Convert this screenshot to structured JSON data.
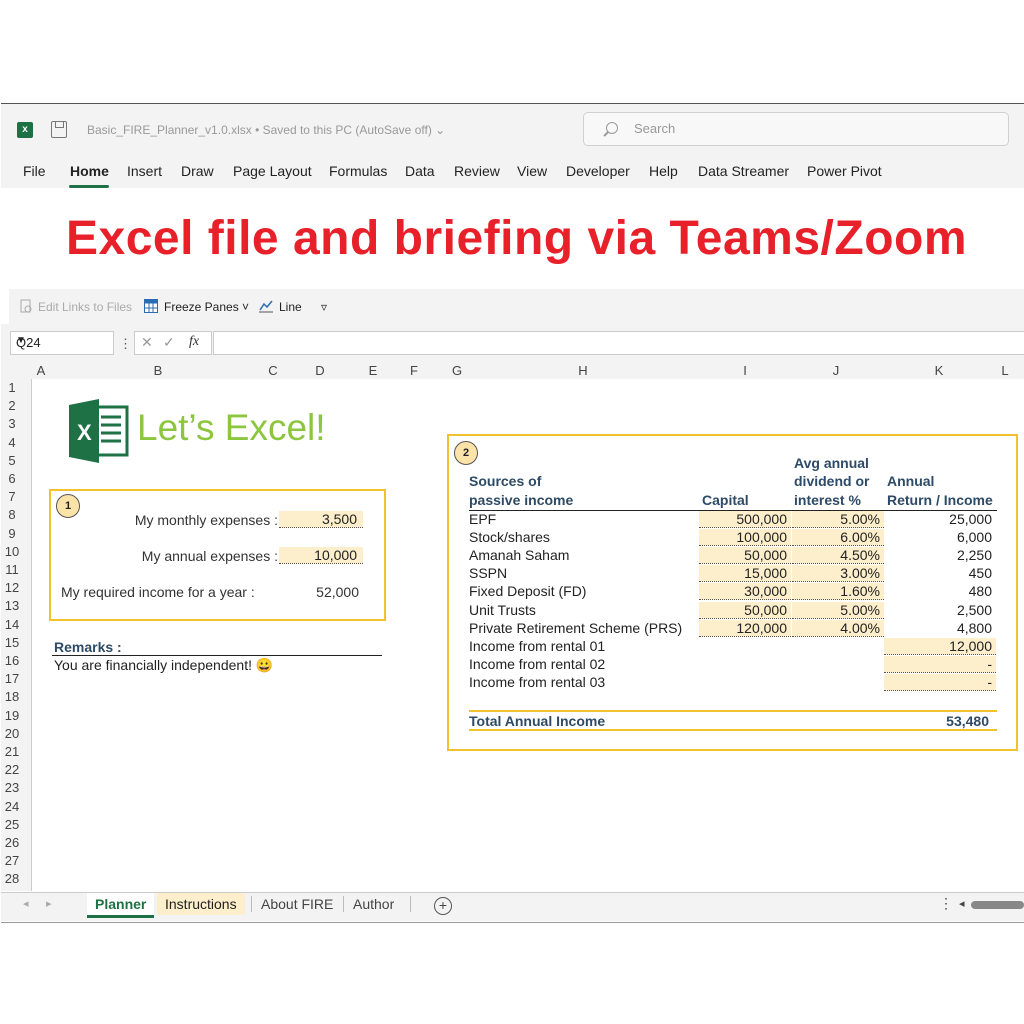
{
  "titlebar": {
    "filename": "Basic_FIRE_Planner_v1.0.xlsx • Saved to this PC (AutoSave off) ⌄",
    "search_placeholder": "Search"
  },
  "menu": [
    "File",
    "Home",
    "Insert",
    "Draw",
    "Page Layout",
    "Formulas",
    "Data",
    "Review",
    "View",
    "Developer",
    "Help",
    "Data Streamer",
    "Power Pivot"
  ],
  "banner": "Excel file and briefing via Teams/Zoom",
  "ribbon": {
    "edit_links": "Edit Links to Files",
    "freeze_panes": "Freeze Panes ˅",
    "line": "Line",
    "more": "▿"
  },
  "formula_bar": {
    "name_box": "Q24",
    "fx": "fx"
  },
  "columns": [
    "A",
    "B",
    "C",
    "D",
    "E",
    "F",
    "G",
    "H",
    "I",
    "J",
    "K",
    "L"
  ],
  "rows": [
    "1",
    "2",
    "3",
    "4",
    "5",
    "6",
    "7",
    "8",
    "9",
    "10",
    "11",
    "12",
    "13",
    "14",
    "15",
    "16",
    "17",
    "18",
    "19",
    "20",
    "21",
    "22",
    "23",
    "24",
    "25",
    "26",
    "27",
    "28"
  ],
  "logo_text": "Let’s Excel!",
  "box1": {
    "badge": "1",
    "monthly_label": "My monthly expenses  :",
    "monthly_value": "3,500",
    "annual_label": "My annual expenses  :",
    "annual_value": "10,000",
    "required_label": "My required income for a year  :",
    "required_value": "52,000"
  },
  "remarks": {
    "title": "Remarks :",
    "value": "You are financially independent! 😀"
  },
  "box2": {
    "badge": "2",
    "headers": {
      "source1": "Sources of",
      "source2": "passive income",
      "capital": "Capital",
      "avg1": "Avg annual",
      "avg2": "dividend or",
      "avg3": "interest %",
      "ret1": "Annual",
      "ret2": "Return / Income"
    },
    "rows": [
      {
        "name": "EPF",
        "capital": "500,000",
        "rate": "5.00%",
        "income": "25,000"
      },
      {
        "name": "Stock/shares",
        "capital": "100,000",
        "rate": "6.00%",
        "income": "6,000"
      },
      {
        "name": "Amanah Saham",
        "capital": "50,000",
        "rate": "4.50%",
        "income": "2,250"
      },
      {
        "name": "SSPN",
        "capital": "15,000",
        "rate": "3.00%",
        "income": "450"
      },
      {
        "name": "Fixed Deposit (FD)",
        "capital": "30,000",
        "rate": "1.60%",
        "income": "480"
      },
      {
        "name": "Unit Trusts",
        "capital": "50,000",
        "rate": "5.00%",
        "income": "2,500"
      },
      {
        "name": "Private Retirement Scheme (PRS)",
        "capital": "120,000",
        "rate": "4.00%",
        "income": "4,800"
      }
    ],
    "rentals": [
      {
        "name": "Income from rental 01",
        "income": "12,000"
      },
      {
        "name": "Income from rental 02",
        "income": "-"
      },
      {
        "name": "Income from rental 03",
        "income": "-"
      }
    ],
    "total_label": "Total Annual Income",
    "total_value": "53,480"
  },
  "sheet_tabs": [
    "Planner",
    "Instructions",
    "About FIRE",
    "Author"
  ],
  "colors": {
    "accent": "#1e7145",
    "banner": "#e8202a",
    "box_border": "#f2c12e",
    "input_fill": "#fdeecc",
    "logo_green": "#8cc63f"
  }
}
